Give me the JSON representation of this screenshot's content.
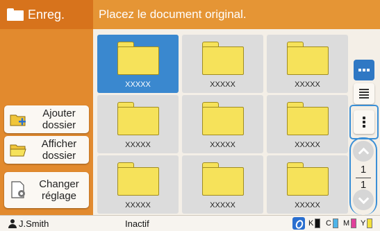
{
  "left_panel": {
    "title": "Enreg.",
    "buttons": [
      {
        "label_line1": "Ajouter",
        "label_line2": "dossier",
        "icon": "folder-add-icon"
      },
      {
        "label_line1": "Afficher",
        "label_line2": "dossier",
        "icon": "folder-open-icon"
      },
      {
        "label_line1": "Changer",
        "label_line2": "réglage",
        "icon": "settings-doc-icon"
      }
    ]
  },
  "header": {
    "message": "Placez le document original."
  },
  "folders": [
    {
      "name": "XXXXX",
      "selected": true
    },
    {
      "name": "XXXXX",
      "selected": false
    },
    {
      "name": "XXXXX",
      "selected": false
    },
    {
      "name": "XXXXX",
      "selected": false
    },
    {
      "name": "XXXXX",
      "selected": false
    },
    {
      "name": "XXXXX",
      "selected": false
    },
    {
      "name": "XXXXX",
      "selected": false
    },
    {
      "name": "XXXXX",
      "selected": false
    },
    {
      "name": "XXXXX",
      "selected": false
    }
  ],
  "pager": {
    "current": "1",
    "total": "1"
  },
  "status": {
    "user": "J.Smith",
    "state": "Inactif",
    "inks": [
      {
        "label": "K",
        "color": "#111111"
      },
      {
        "label": "C",
        "color": "#4fb4e8"
      },
      {
        "label": "M",
        "color": "#e0409a"
      },
      {
        "label": "Y",
        "color": "#f3e13b"
      }
    ]
  },
  "colors": {
    "accent_orange": "#e28a2e",
    "header_orange": "#e59535",
    "selection_blue": "#3a88cf",
    "folder_yellow": "#f6e25a"
  }
}
